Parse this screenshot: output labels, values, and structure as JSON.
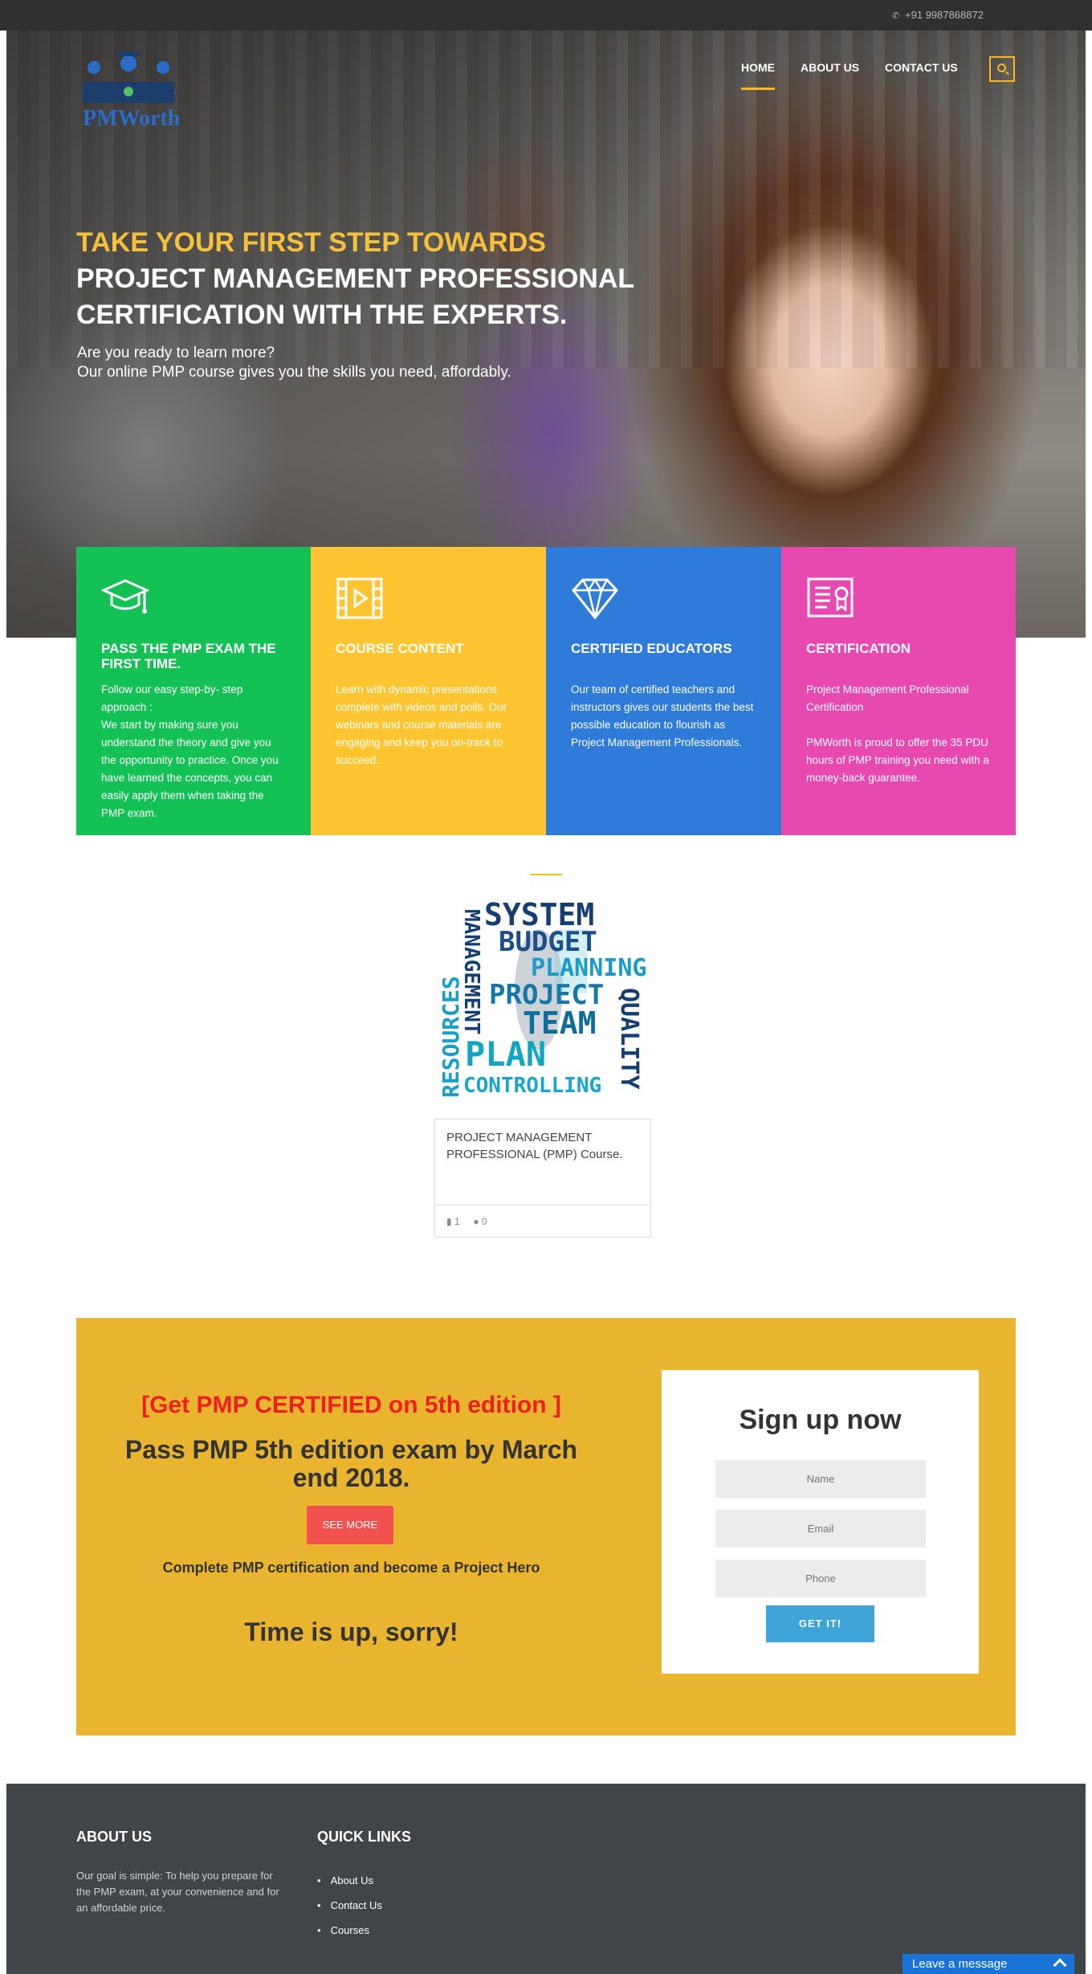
{
  "topbar": {
    "phone": "+91 9987868872",
    "phone_icon": "phone-icon"
  },
  "header": {
    "logo_text": "PMWorth",
    "nav": [
      {
        "label": "HOME",
        "active": true
      },
      {
        "label": "ABOUT US",
        "active": false
      },
      {
        "label": "CONTACT US",
        "active": false
      }
    ],
    "search_icon": "search-icon",
    "accent": "#f5b921"
  },
  "hero": {
    "headline_highlight": "TAKE YOUR FIRST STEP TOWARDS",
    "headline_line2": "PROJECT MANAGEMENT PROFESSIONAL",
    "headline_line3": "CERTIFICATION WITH THE EXPERTS.",
    "sub_line1": "Are you ready to learn more?",
    "sub_line2": "Our online PMP course gives you the skills you need, affordably."
  },
  "features": [
    {
      "icon": "graduation-cap-icon",
      "color": "#13c155",
      "title": "PASS THE PMP EXAM THE FIRST TIME.",
      "text": "Follow our easy step-by- step approach :\nWe start by making sure you understand the theory and give you the opportunity to practice. Once you have learned the concepts, you can easily apply them when taking the PMP exam."
    },
    {
      "icon": "film-icon",
      "color": "#ffc531",
      "title": "COURSE CONTENT",
      "text": "Learn with dynamic presentations complete with videos and polls. Our webinars and course materials are engaging and keep you on-track to succeed."
    },
    {
      "icon": "diamond-icon",
      "color": "#2f7bd9",
      "title": "CERTIFIED EDUCATORS",
      "text": "Our team of certified teachers and instructors gives our students the best possible education to flourish as Project Management Professionals."
    },
    {
      "icon": "certificate-icon",
      "color": "#e849b0",
      "title": "CERTIFICATION",
      "text": "Project Management Professional Certification\n\nPMWorth is proud to offer the 35 PDU hours of PMP training you need with a money-back guarantee."
    }
  ],
  "course": {
    "title": "PROJECT MANAGEMENT PROFESSIONAL (PMP) Course.",
    "comments": "1",
    "students": "0",
    "image_words": [
      "SYSTEM",
      "BUDGET",
      "PLANNING",
      "PROJECT",
      "TEAM",
      "PLAN",
      "CONTROLLING",
      "MANAGEMENT",
      "RESOURCES",
      "QUALITY"
    ]
  },
  "promo": {
    "headline": "[Get PMP CERTIFIED on 5th edition ]",
    "subheadline": "Pass PMP 5th edition exam by March end 2018.",
    "button": "SEE MORE",
    "tagline": "Complete PMP certification and become a Project Hero",
    "countdown": "Time is up, sorry!",
    "background": "#e9b52e"
  },
  "signup": {
    "title": "Sign up now",
    "name_placeholder": "Name",
    "email_placeholder": "Email",
    "phone_placeholder": "Phone",
    "button": "GET IT!"
  },
  "footer": {
    "about_title": "ABOUT US",
    "about_text": "Our goal is simple: To help you prepare for the PMP exam, at your convenience and for an affordable price.",
    "links_title": "QUICK LINKS",
    "links": [
      "About Us",
      "Contact Us",
      "Courses"
    ]
  },
  "chat": {
    "label": "Leave a message"
  }
}
